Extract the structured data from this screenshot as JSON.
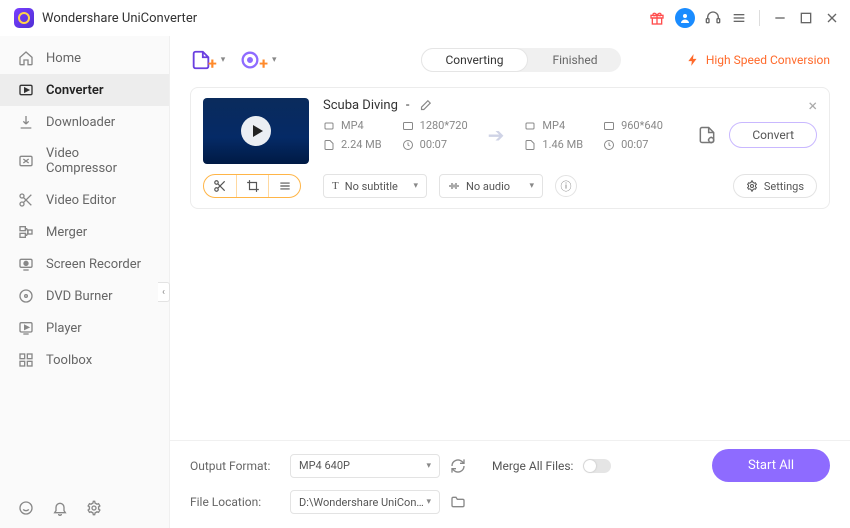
{
  "app": {
    "title": "Wondershare UniConverter"
  },
  "sidebar": {
    "items": [
      {
        "label": "Home"
      },
      {
        "label": "Converter"
      },
      {
        "label": "Downloader"
      },
      {
        "label": "Video Compressor"
      },
      {
        "label": "Video Editor"
      },
      {
        "label": "Merger"
      },
      {
        "label": "Screen Recorder"
      },
      {
        "label": "DVD Burner"
      },
      {
        "label": "Player"
      },
      {
        "label": "Toolbox"
      }
    ]
  },
  "tabs": {
    "converting": "Converting",
    "finished": "Finished"
  },
  "highspeed": "High Speed Conversion",
  "file": {
    "title": "Scuba Diving",
    "dash": " - ",
    "src": {
      "format": "MP4",
      "resolution": "1280*720",
      "size": "2.24 MB",
      "duration": "00:07"
    },
    "dst": {
      "format": "MP4",
      "resolution": "960*640",
      "size": "1.46 MB",
      "duration": "00:07"
    },
    "convert": "Convert",
    "subtitle": "No subtitle",
    "audio": "No audio",
    "settings": "Settings"
  },
  "footer": {
    "output_format_label": "Output Format:",
    "output_format_value": "MP4 640P",
    "merge_label": "Merge All Files:",
    "file_location_label": "File Location:",
    "file_location_value": "D:\\Wondershare UniConverter",
    "start_all": "Start All"
  }
}
